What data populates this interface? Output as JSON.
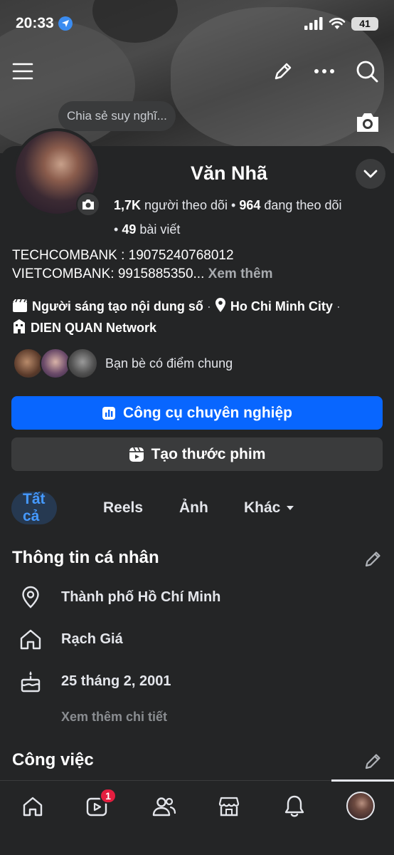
{
  "status_bar": {
    "time": "20:33",
    "battery": "41"
  },
  "cover": {
    "composer_prompt": "Chia sẻ suy nghĩ..."
  },
  "profile": {
    "name": "Văn Nhã",
    "followers_count": "1,7K",
    "followers_label": "người theo dõi",
    "following_count": "964",
    "following_label": "đang theo dõi",
    "posts_count": "49",
    "posts_label": "bài viết",
    "bio_line1": "TECHCOMBANK : 19075240768012",
    "bio_line2": "VIETCOMBANK: 9915885350...",
    "bio_see_more": "Xem thêm",
    "category": "Người sáng tạo nội dung số",
    "location": "Ho Chi Minh City",
    "network": "DIEN QUAN Network",
    "mutual_friends_label": "Bạn bè có điểm chung"
  },
  "buttons": {
    "professional_tools": "Công cụ chuyên nghiệp",
    "create_reel": "Tạo thước phim"
  },
  "tabs": [
    {
      "label": "Tất cả",
      "active": true
    },
    {
      "label": "Reels",
      "active": false
    },
    {
      "label": "Ảnh",
      "active": false
    },
    {
      "label": "Khác",
      "active": false
    }
  ],
  "personal_info": {
    "title": "Thông tin cá nhân",
    "current_city": "Thành phố Hồ Chí Minh",
    "hometown": "Rạch Giá",
    "birthday": "25 tháng 2, 2001",
    "see_details": "Xem thêm chi tiết"
  },
  "work": {
    "title": "Công việc"
  },
  "bottom_nav": {
    "video_badge": "1"
  },
  "colors": {
    "accent": "#0866ff",
    "background": "#242526",
    "surface": "#3a3b3c",
    "badge": "#e41e3f"
  }
}
